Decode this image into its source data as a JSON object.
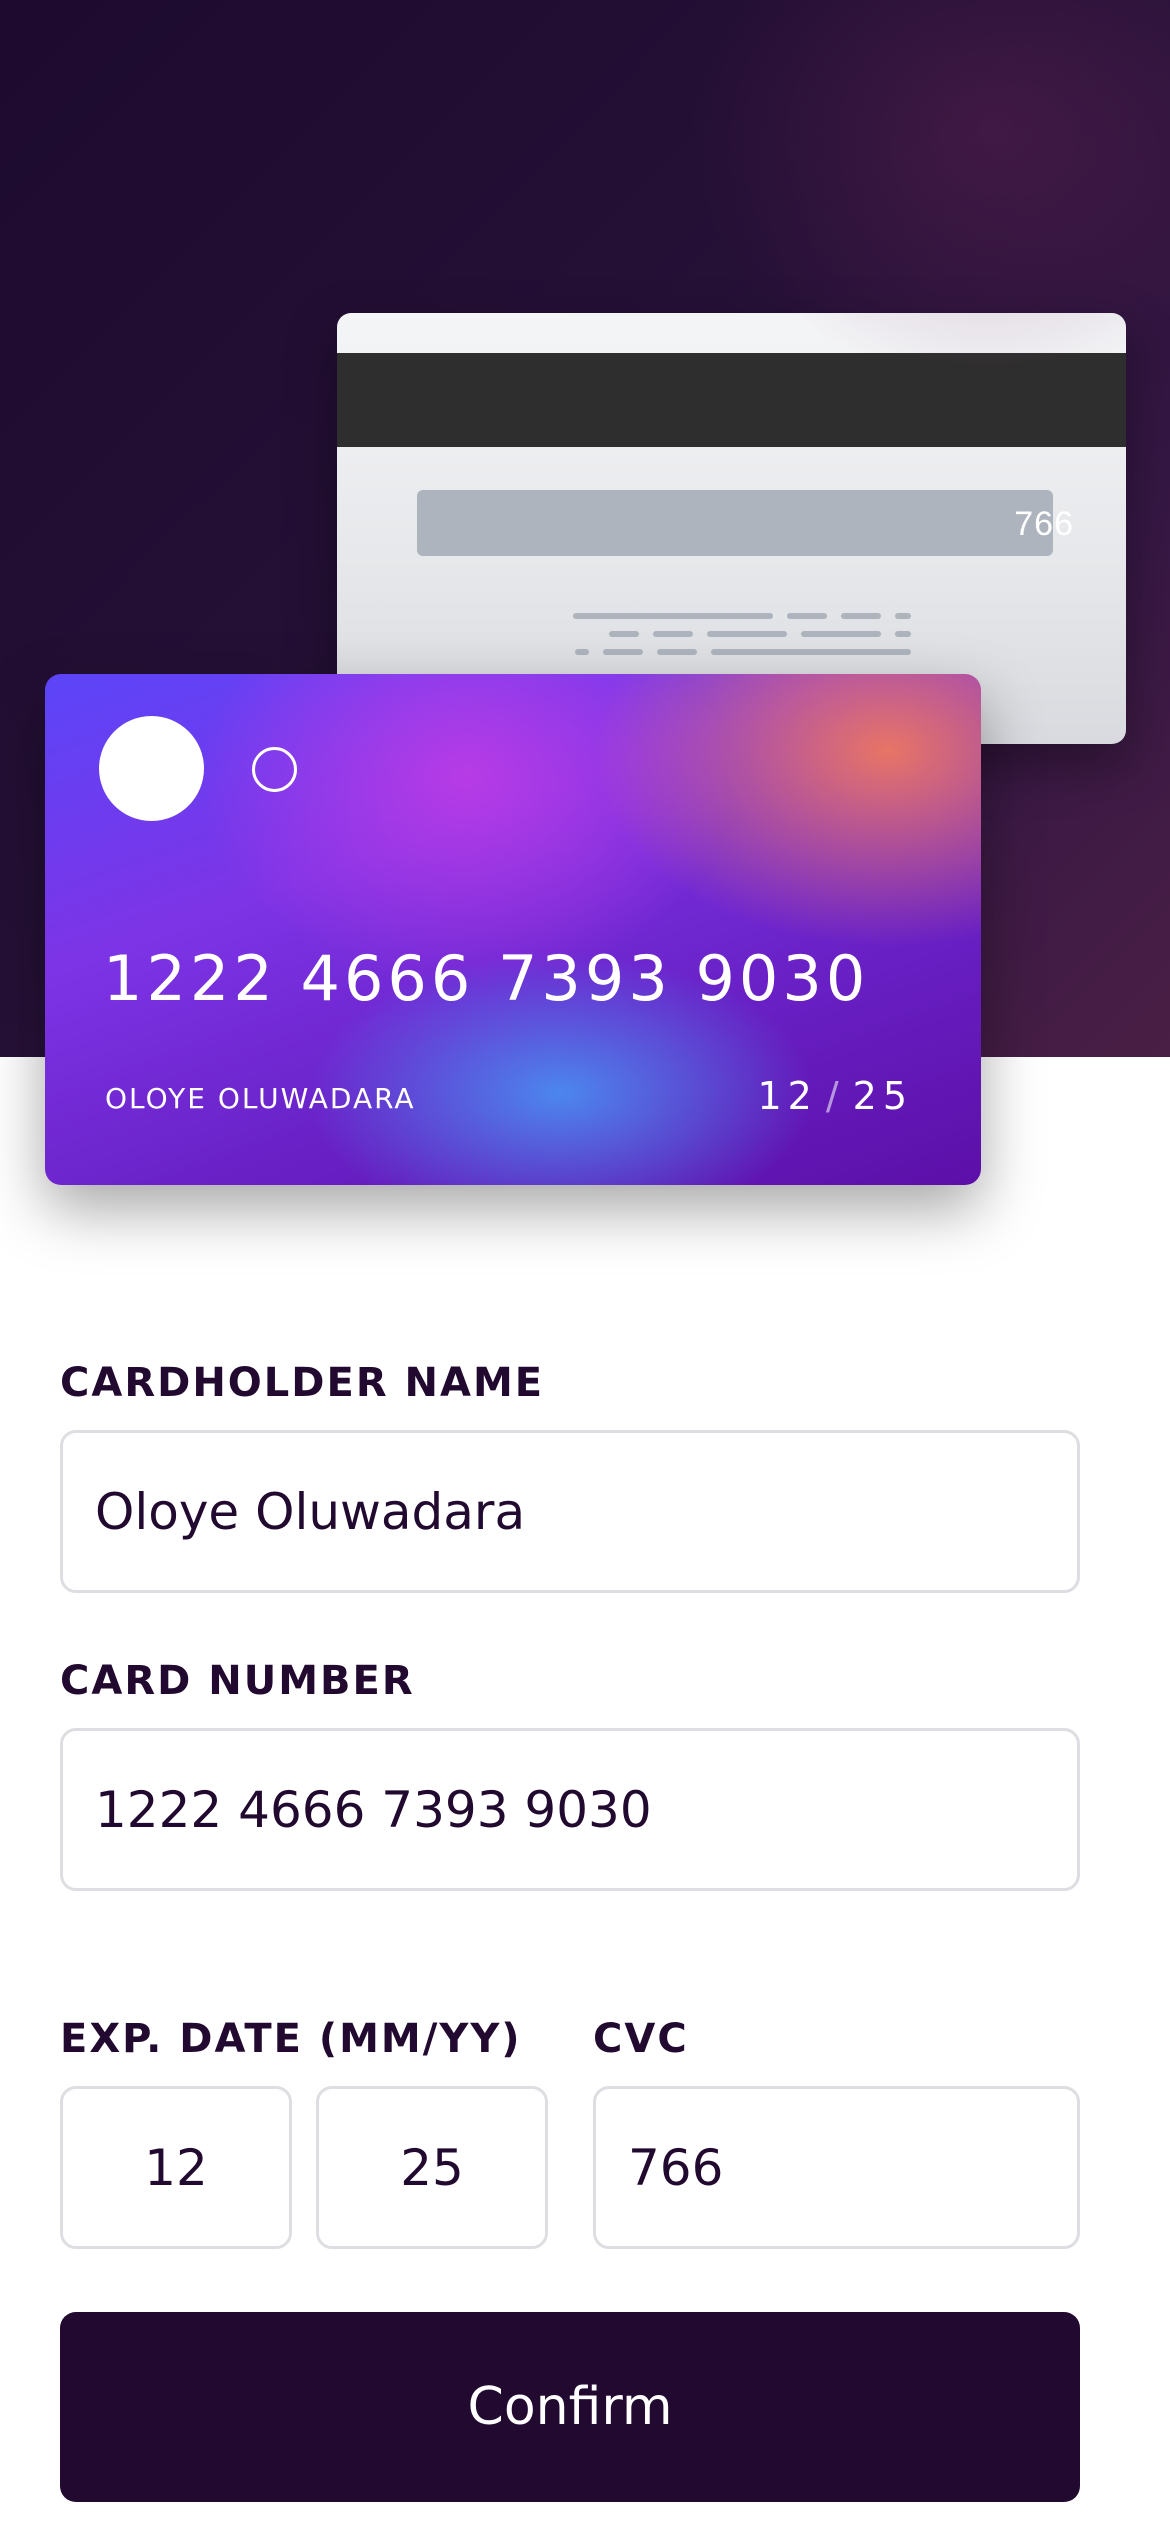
{
  "card": {
    "number": "1222 4666 7393 9030",
    "holder": "OLOYE OLUWADARA",
    "exp_month": "12",
    "exp_separator": "/",
    "exp_year": "25",
    "cvc": "766"
  },
  "form": {
    "cardholder_label": "CARDHOLDER NAME",
    "cardholder_value": "Oloye Oluwadara",
    "card_number_label": "CARD NUMBER",
    "card_number_value": "1222 4666 7393 9030",
    "exp_label": "EXP. DATE (MM/YY)",
    "exp_month_value": "12",
    "exp_year_value": "25",
    "cvc_label": "CVC",
    "cvc_value": "766"
  },
  "confirm_label": "Confirm",
  "colors": {
    "hero_bg": "#251036",
    "primary": "#21092f",
    "input_border": "#dedde1",
    "card_gradient_start": "#5c45f8",
    "card_gradient_end": "#5c0fa8"
  }
}
